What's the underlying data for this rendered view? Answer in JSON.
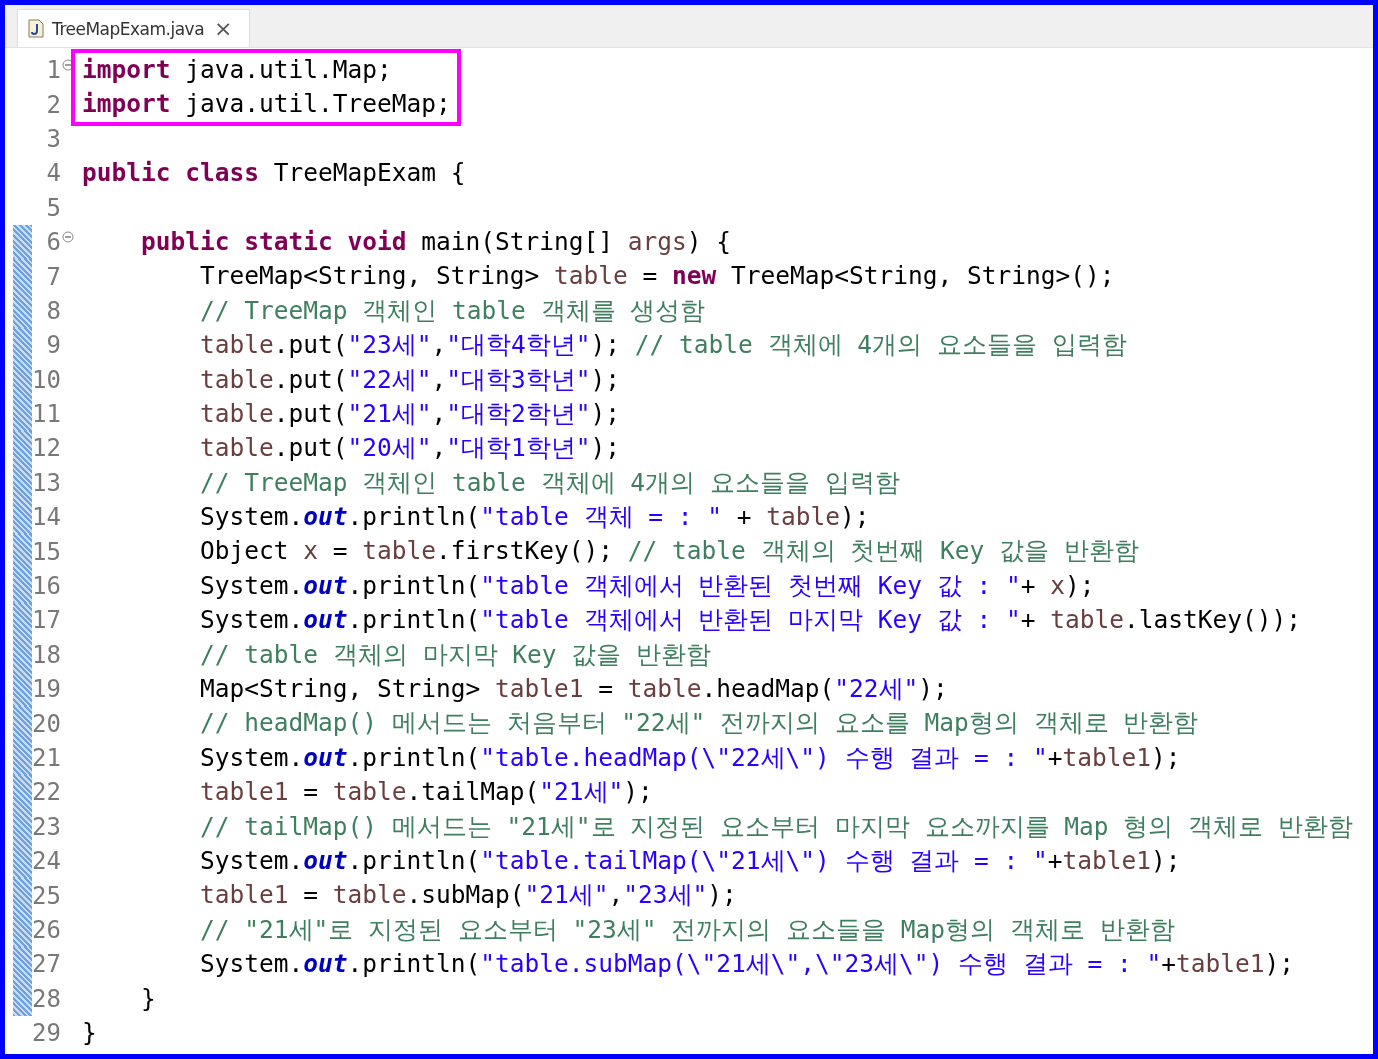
{
  "tab": {
    "title": "TreeMapExam.java",
    "close": "×",
    "selected": true
  },
  "lines": [
    {
      "number": "1",
      "fold": true,
      "changed": false,
      "highlighted": true,
      "tokens": [
        {
          "kind": "keyword",
          "text": "import"
        },
        {
          "kind": "plain",
          "text": " java.util.Map;"
        }
      ]
    },
    {
      "number": "2",
      "fold": false,
      "changed": false,
      "highlighted": true,
      "tokens": [
        {
          "kind": "keyword",
          "text": "import"
        },
        {
          "kind": "plain",
          "text": " java.util.TreeMap;"
        }
      ]
    },
    {
      "number": "3",
      "fold": false,
      "changed": false,
      "highlighted": false
    },
    {
      "number": "4",
      "fold": false,
      "changed": false,
      "highlighted": false,
      "tokens": [
        {
          "kind": "keyword",
          "text": "public class"
        },
        {
          "kind": "plain",
          "text": " TreeMapExam {"
        }
      ],
      "children": [
        {
          "number": "5",
          "fold": false,
          "changed": false,
          "highlighted": false
        },
        {
          "number": "6",
          "fold": true,
          "changed": true,
          "highlighted": false,
          "tokens": [
            {
              "kind": "keyword",
              "text": "public static void"
            },
            {
              "kind": "plain",
              "text": " main(String[] "
            },
            {
              "kind": "variable",
              "text": "args"
            },
            {
              "kind": "plain",
              "text": ") {"
            }
          ],
          "children": [
            {
              "number": "7",
              "fold": false,
              "changed": true,
              "highlighted": false,
              "tokens": [
                {
                  "kind": "plain",
                  "text": "TreeMap<String, String> "
                },
                {
                  "kind": "variable",
                  "text": "table"
                },
                {
                  "kind": "plain",
                  "text": " = "
                },
                {
                  "kind": "keyword",
                  "text": "new"
                },
                {
                  "kind": "plain",
                  "text": " TreeMap<String, String>();"
                }
              ]
            },
            {
              "number": "8",
              "fold": false,
              "changed": true,
              "highlighted": false,
              "tokens": [
                {
                  "kind": "comment",
                  "text": "// TreeMap 객체인 table 객체를 생성함"
                }
              ]
            },
            {
              "number": "9",
              "fold": false,
              "changed": true,
              "highlighted": false,
              "tokens": [
                {
                  "kind": "variable",
                  "text": "table"
                },
                {
                  "kind": "plain",
                  "text": ".put("
                },
                {
                  "kind": "string",
                  "text": "\"23세\""
                },
                {
                  "kind": "plain",
                  "text": ","
                },
                {
                  "kind": "string",
                  "text": "\"대학4학년\""
                },
                {
                  "kind": "plain",
                  "text": "); "
                },
                {
                  "kind": "comment",
                  "text": "// table 객체에 4개의 요소들을 입력함"
                }
              ]
            },
            {
              "number": "10",
              "fold": false,
              "changed": true,
              "highlighted": false,
              "tokens": [
                {
                  "kind": "variable",
                  "text": "table"
                },
                {
                  "kind": "plain",
                  "text": ".put("
                },
                {
                  "kind": "string",
                  "text": "\"22세\""
                },
                {
                  "kind": "plain",
                  "text": ","
                },
                {
                  "kind": "string",
                  "text": "\"대학3학년\""
                },
                {
                  "kind": "plain",
                  "text": ");"
                }
              ]
            },
            {
              "number": "11",
              "fold": false,
              "changed": true,
              "highlighted": false,
              "tokens": [
                {
                  "kind": "variable",
                  "text": "table"
                },
                {
                  "kind": "plain",
                  "text": ".put("
                },
                {
                  "kind": "string",
                  "text": "\"21세\""
                },
                {
                  "kind": "plain",
                  "text": ","
                },
                {
                  "kind": "string",
                  "text": "\"대학2학년\""
                },
                {
                  "kind": "plain",
                  "text": ");"
                }
              ]
            },
            {
              "number": "12",
              "fold": false,
              "changed": true,
              "highlighted": false,
              "tokens": [
                {
                  "kind": "variable",
                  "text": "table"
                },
                {
                  "kind": "plain",
                  "text": ".put("
                },
                {
                  "kind": "string",
                  "text": "\"20세\""
                },
                {
                  "kind": "plain",
                  "text": ","
                },
                {
                  "kind": "string",
                  "text": "\"대학1학년\""
                },
                {
                  "kind": "plain",
                  "text": ");"
                }
              ]
            },
            {
              "number": "13",
              "fold": false,
              "changed": true,
              "highlighted": false,
              "tokens": [
                {
                  "kind": "comment",
                  "text": "// TreeMap 객체인 table 객체에 4개의 요소들을 입력함"
                }
              ]
            },
            {
              "number": "14",
              "fold": false,
              "changed": true,
              "highlighted": false,
              "tokens": [
                {
                  "kind": "plain",
                  "text": "System."
                },
                {
                  "kind": "static",
                  "text": "out"
                },
                {
                  "kind": "plain",
                  "text": ".println("
                },
                {
                  "kind": "string",
                  "text": "\"table 객체 = : \""
                },
                {
                  "kind": "plain",
                  "text": " + "
                },
                {
                  "kind": "variable",
                  "text": "table"
                },
                {
                  "kind": "plain",
                  "text": ");"
                }
              ]
            },
            {
              "number": "15",
              "fold": false,
              "changed": true,
              "highlighted": false,
              "tokens": [
                {
                  "kind": "plain",
                  "text": "Object "
                },
                {
                  "kind": "variable",
                  "text": "x"
                },
                {
                  "kind": "plain",
                  "text": " = "
                },
                {
                  "kind": "variable",
                  "text": "table"
                },
                {
                  "kind": "plain",
                  "text": ".firstKey(); "
                },
                {
                  "kind": "comment",
                  "text": "// table 객체의 첫번째 Key 값을 반환함"
                }
              ]
            },
            {
              "number": "16",
              "fold": false,
              "changed": true,
              "highlighted": false,
              "tokens": [
                {
                  "kind": "plain",
                  "text": "System."
                },
                {
                  "kind": "static",
                  "text": "out"
                },
                {
                  "kind": "plain",
                  "text": ".println("
                },
                {
                  "kind": "string",
                  "text": "\"table 객체에서 반환된 첫번째 Key 값 : \""
                },
                {
                  "kind": "plain",
                  "text": "+ "
                },
                {
                  "kind": "variable",
                  "text": "x"
                },
                {
                  "kind": "plain",
                  "text": ");"
                }
              ]
            },
            {
              "number": "17",
              "fold": false,
              "changed": true,
              "highlighted": false,
              "tokens": [
                {
                  "kind": "plain",
                  "text": "System."
                },
                {
                  "kind": "static",
                  "text": "out"
                },
                {
                  "kind": "plain",
                  "text": ".println("
                },
                {
                  "kind": "string",
                  "text": "\"table 객체에서 반환된 마지막 Key 값 : \""
                },
                {
                  "kind": "plain",
                  "text": "+ "
                },
                {
                  "kind": "variable",
                  "text": "table"
                },
                {
                  "kind": "plain",
                  "text": ".lastKey());"
                }
              ]
            },
            {
              "number": "18",
              "fold": false,
              "changed": true,
              "highlighted": false,
              "tokens": [
                {
                  "kind": "comment",
                  "text": "// table 객체의 마지막 Key 값을 반환함"
                }
              ]
            },
            {
              "number": "19",
              "fold": false,
              "changed": true,
              "highlighted": false,
              "tokens": [
                {
                  "kind": "plain",
                  "text": "Map<String, String> "
                },
                {
                  "kind": "variable",
                  "text": "table1"
                },
                {
                  "kind": "plain",
                  "text": " = "
                },
                {
                  "kind": "variable",
                  "text": "table"
                },
                {
                  "kind": "plain",
                  "text": ".headMap("
                },
                {
                  "kind": "string",
                  "text": "\"22세\""
                },
                {
                  "kind": "plain",
                  "text": ");"
                }
              ]
            },
            {
              "number": "20",
              "fold": false,
              "changed": true,
              "highlighted": false,
              "tokens": [
                {
                  "kind": "comment",
                  "text": "// headMap() 메서드는 처음부터 \"22세\" 전까지의 요소를 Map형의 객체로 반환함"
                }
              ]
            },
            {
              "number": "21",
              "fold": false,
              "changed": true,
              "highlighted": false,
              "tokens": [
                {
                  "kind": "plain",
                  "text": "System."
                },
                {
                  "kind": "static",
                  "text": "out"
                },
                {
                  "kind": "plain",
                  "text": ".println("
                },
                {
                  "kind": "string",
                  "text": "\"table.headMap(\\\"22세\\\") 수행 결과 = : \""
                },
                {
                  "kind": "plain",
                  "text": "+"
                },
                {
                  "kind": "variable",
                  "text": "table1"
                },
                {
                  "kind": "plain",
                  "text": ");"
                }
              ]
            },
            {
              "number": "22",
              "fold": false,
              "changed": true,
              "highlighted": false,
              "tokens": [
                {
                  "kind": "variable",
                  "text": "table1"
                },
                {
                  "kind": "plain",
                  "text": " = "
                },
                {
                  "kind": "variable",
                  "text": "table"
                },
                {
                  "kind": "plain",
                  "text": ".tailMap("
                },
                {
                  "kind": "string",
                  "text": "\"21세\""
                },
                {
                  "kind": "plain",
                  "text": ");"
                }
              ]
            },
            {
              "number": "23",
              "fold": false,
              "changed": true,
              "highlighted": false,
              "tokens": [
                {
                  "kind": "comment",
                  "text": "// tailMap() 메서드는 \"21세\"로 지정된 요소부터 마지막 요소까지를 Map 형의 객체로 반환함"
                }
              ]
            },
            {
              "number": "24",
              "fold": false,
              "changed": true,
              "highlighted": false,
              "tokens": [
                {
                  "kind": "plain",
                  "text": "System."
                },
                {
                  "kind": "static",
                  "text": "out"
                },
                {
                  "kind": "plain",
                  "text": ".println("
                },
                {
                  "kind": "string",
                  "text": "\"table.tailMap(\\\"21세\\\") 수행 결과 = : \""
                },
                {
                  "kind": "plain",
                  "text": "+"
                },
                {
                  "kind": "variable",
                  "text": "table1"
                },
                {
                  "kind": "plain",
                  "text": ");"
                }
              ]
            },
            {
              "number": "25",
              "fold": false,
              "changed": true,
              "highlighted": false,
              "tokens": [
                {
                  "kind": "variable",
                  "text": "table1"
                },
                {
                  "kind": "plain",
                  "text": " = "
                },
                {
                  "kind": "variable",
                  "text": "table"
                },
                {
                  "kind": "plain",
                  "text": ".subMap("
                },
                {
                  "kind": "string",
                  "text": "\"21세\""
                },
                {
                  "kind": "plain",
                  "text": ","
                },
                {
                  "kind": "string",
                  "text": "\"23세\""
                },
                {
                  "kind": "plain",
                  "text": ");"
                }
              ]
            },
            {
              "number": "26",
              "fold": false,
              "changed": true,
              "highlighted": false,
              "tokens": [
                {
                  "kind": "comment",
                  "text": "// \"21세\"로 지정된 요소부터 \"23세\" 전까지의 요소들을 Map형의 객체로 반환함"
                }
              ]
            },
            {
              "number": "27",
              "fold": false,
              "changed": true,
              "highlighted": false,
              "tokens": [
                {
                  "kind": "plain",
                  "text": "System."
                },
                {
                  "kind": "static",
                  "text": "out"
                },
                {
                  "kind": "plain",
                  "text": ".println("
                },
                {
                  "kind": "string",
                  "text": "\"table.subMap(\\\"21세\\\",\\\"23세\\\") 수행 결과 = : \""
                },
                {
                  "kind": "plain",
                  "text": "+"
                },
                {
                  "kind": "variable",
                  "text": "table1"
                },
                {
                  "kind": "plain",
                  "text": ");"
                }
              ]
            }
          ]
        },
        {
          "number": "28",
          "fold": false,
          "changed": true,
          "highlighted": false,
          "tokens": [
            {
              "kind": "plain",
              "text": "}"
            }
          ]
        }
      ]
    },
    {
      "number": "29",
      "fold": false,
      "changed": false,
      "highlighted": false,
      "tokens": [
        {
          "kind": "plain",
          "text": "}"
        }
      ]
    }
  ]
}
